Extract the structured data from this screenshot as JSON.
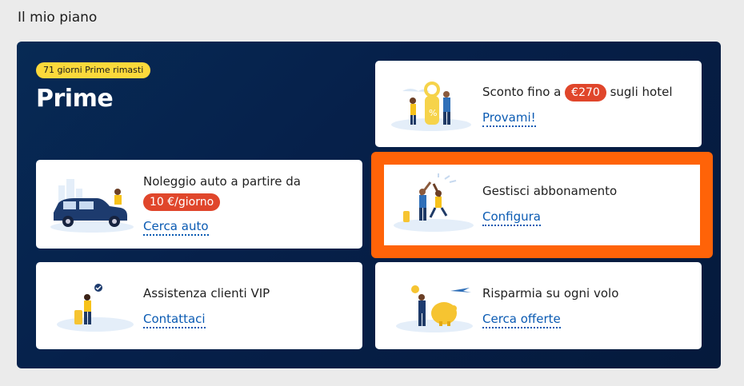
{
  "page_title": "Il mio piano",
  "prime": {
    "badge": "71 giorni Prime rimasti",
    "title": "Prime"
  },
  "cards": {
    "hotel": {
      "title_before": "Sconto fino a",
      "price": "€270",
      "title_after": "sugli hotel",
      "link": "Provami!"
    },
    "car": {
      "title": "Noleggio auto a partire da",
      "price": "10 €/giorno",
      "link": "Cerca auto"
    },
    "subscription": {
      "title": "Gestisci abbonamento",
      "link": "Configura"
    },
    "vip": {
      "title": "Assistenza clienti VIP",
      "link": "Contattaci"
    },
    "flight": {
      "title": "Risparmia su ogni volo",
      "link": "Cerca offerte"
    }
  },
  "colors": {
    "panel_bg": "#06204a",
    "badge_bg": "#fcd93b",
    "price_pill": "#e0462b",
    "link": "#0b5bb3",
    "highlight": "#ff6308"
  }
}
